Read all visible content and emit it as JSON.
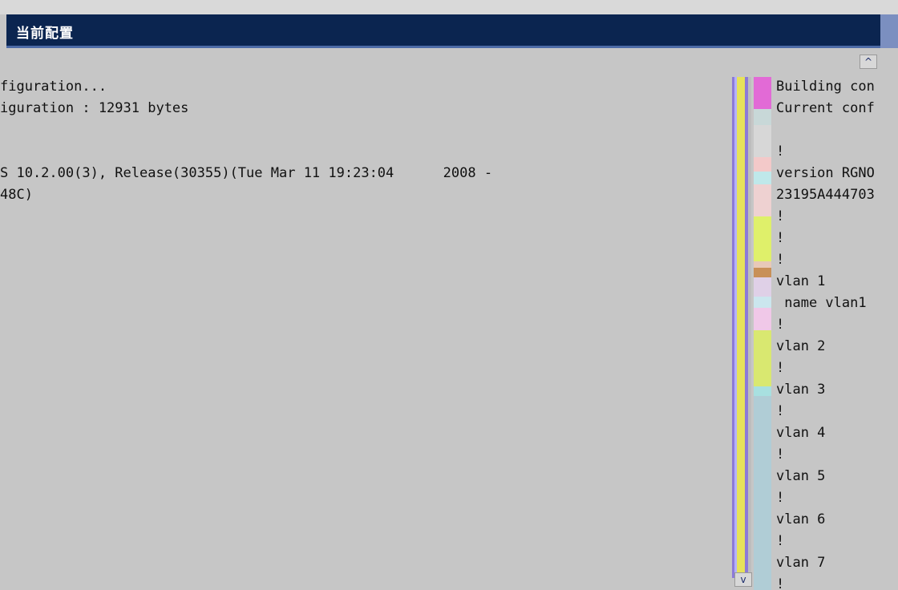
{
  "window": {
    "title": "当前配置"
  },
  "left_lines": [
    "figuration...",
    "iguration : 12931 bytes",
    "",
    "",
    "S 10.2.00(3), Release(30355)(Tue Mar 11 19:23:04      2008 -",
    "48C)"
  ],
  "right_lines": [
    "Building con",
    "Current conf",
    "",
    "!",
    "version RGNO",
    "23195A444703",
    "!",
    "!",
    "!",
    "vlan 1",
    " name vlan1",
    "!",
    "vlan 2",
    "!",
    "vlan 3",
    "!",
    "vlan 4",
    "!",
    "vlan 5",
    "!",
    "vlan 6",
    "!",
    "vlan 7",
    "!"
  ],
  "scrollbar": {
    "up_glyph": "^",
    "down_glyph": "v"
  },
  "colors": {
    "title_bar": "#0b2550",
    "background": "#c6c6c6",
    "scroll_purple": "#8c7ad8",
    "scroll_yellow": "#e6e25a"
  }
}
